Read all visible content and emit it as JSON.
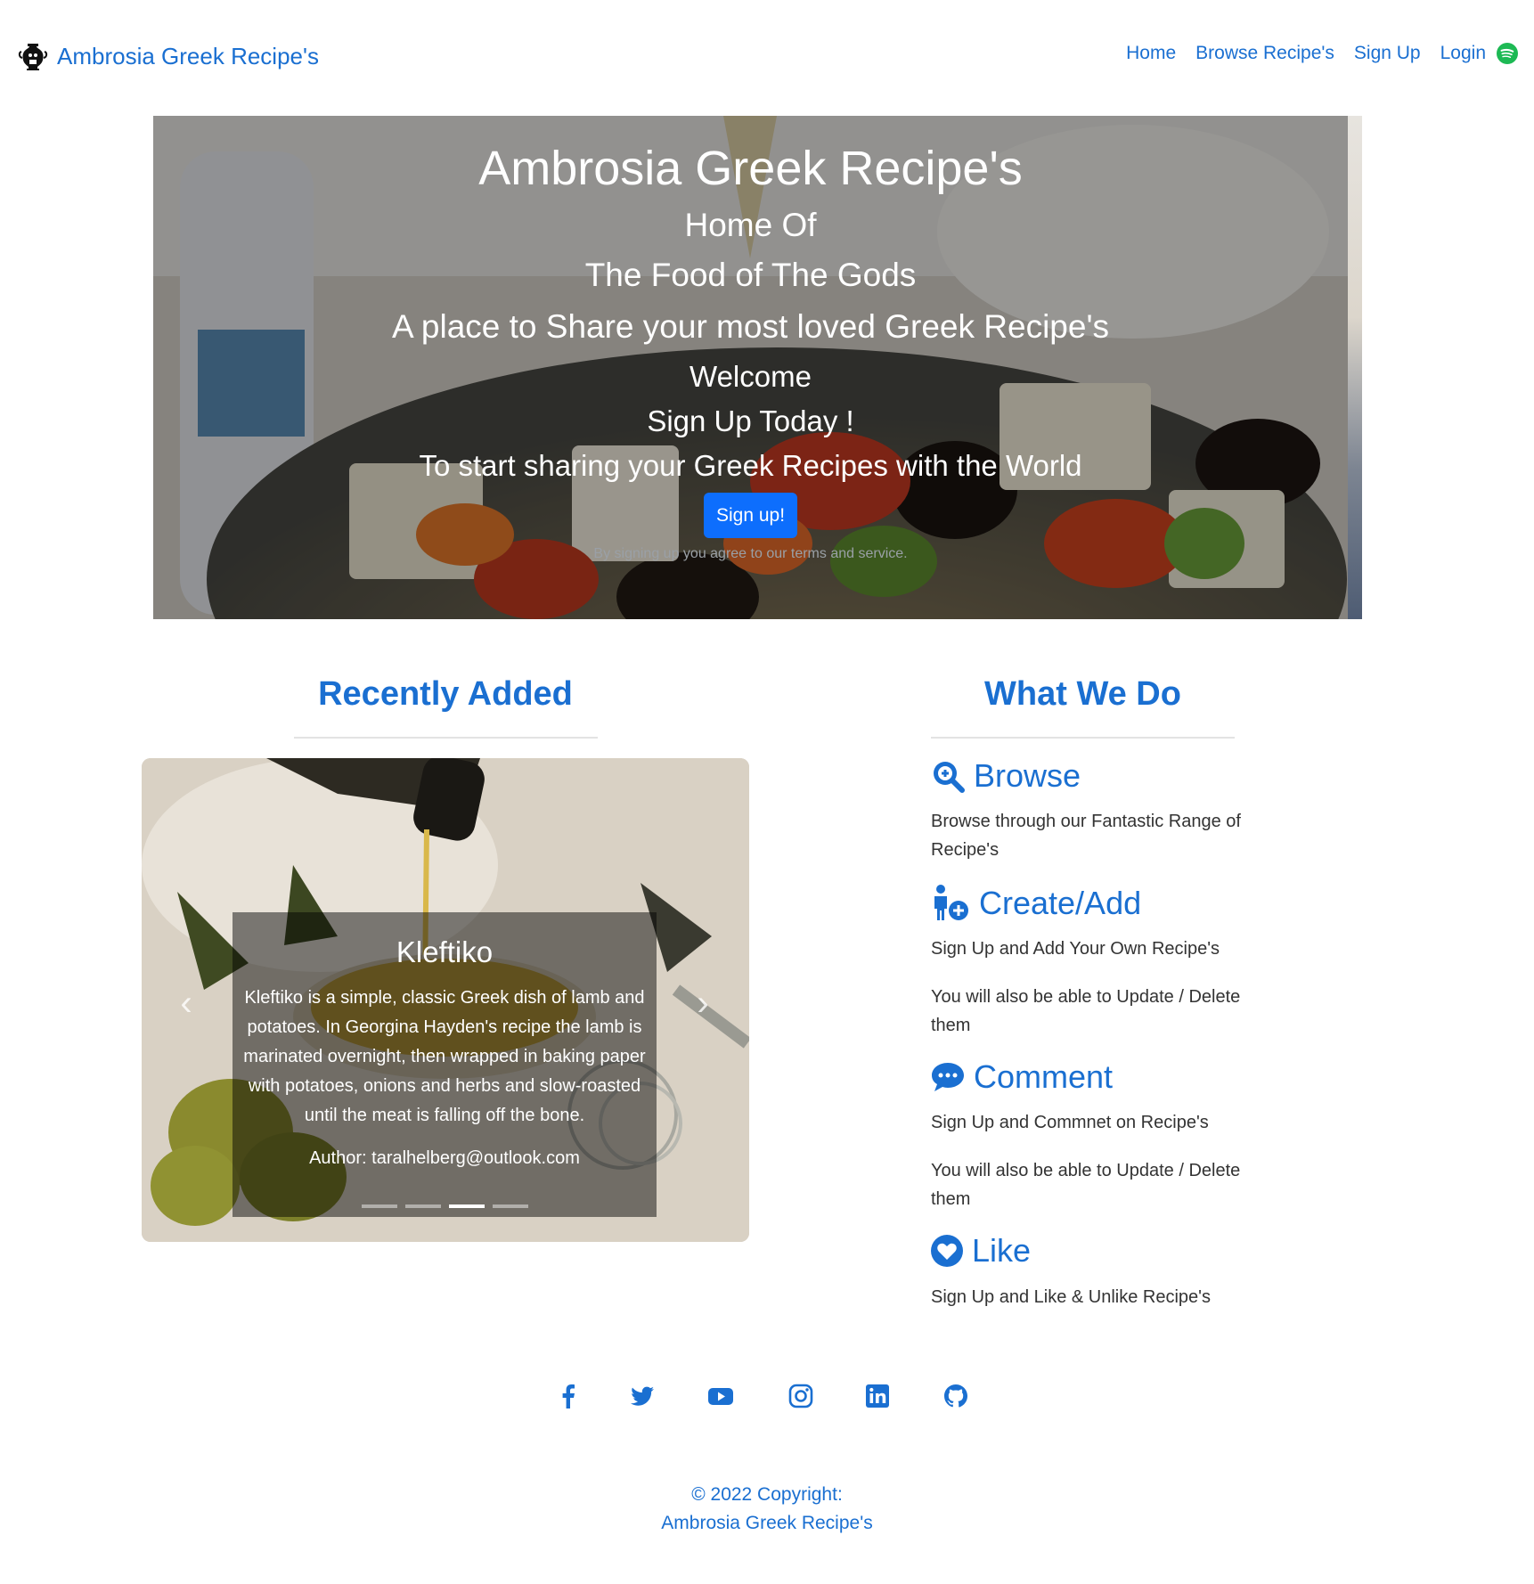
{
  "navbar": {
    "brand": "Ambrosia Greek Recipe's",
    "links": [
      "Home",
      "Browse Recipe's",
      "Sign Up",
      "Login"
    ]
  },
  "hero": {
    "title": "Ambrosia Greek Recipe's",
    "line1": "Home Of",
    "line2": "The Food of The Gods",
    "line3": "A place to Share your most loved Greek Recipe's",
    "line4": "Welcome",
    "line5": "Sign Up Today !",
    "line6": "To start sharing your Greek Recipes with the World",
    "button": "Sign up!",
    "terms": "By signing up you agree to our terms and service."
  },
  "recent": {
    "title": "Recently Added",
    "slide": {
      "title": "Kleftiko",
      "description": "Kleftiko is a simple, classic Greek dish of lamb and potatoes. In Georgina Hayden's recipe the lamb is marinated overnight, then wrapped in baking paper with potatoes, onions and herbs and slow-roasted until the meat is falling off the bone.",
      "author": "Author: taralhelberg@outlook.com"
    },
    "slide_count": 4,
    "active_slide": 3
  },
  "what_we_do": {
    "title": "What We Do",
    "browse": {
      "title": "Browse",
      "text": "Browse through our Fantastic Range of Recipe's"
    },
    "create": {
      "title": "Create/Add",
      "text": "Sign Up and Add Your Own Recipe's",
      "text2": "You will also be able to Update / Delete them"
    },
    "comment": {
      "title": "Comment",
      "text": "Sign Up and Commnet on Recipe's",
      "text2": "You will also be able to Update / Delete them"
    },
    "like": {
      "title": "Like",
      "text": "Sign Up and Like & Unlike Recipe's"
    }
  },
  "social": [
    "facebook-icon",
    "twitter-icon",
    "youtube-icon",
    "instagram-icon",
    "linkedin-icon",
    "github-icon"
  ],
  "footer": {
    "copyright": "© 2022 Copyright:",
    "brand": "Ambrosia Greek Recipe's"
  },
  "colors": {
    "link": "#1a6fd1",
    "primary_button": "#0d6efd",
    "spotify": "#1db954"
  }
}
